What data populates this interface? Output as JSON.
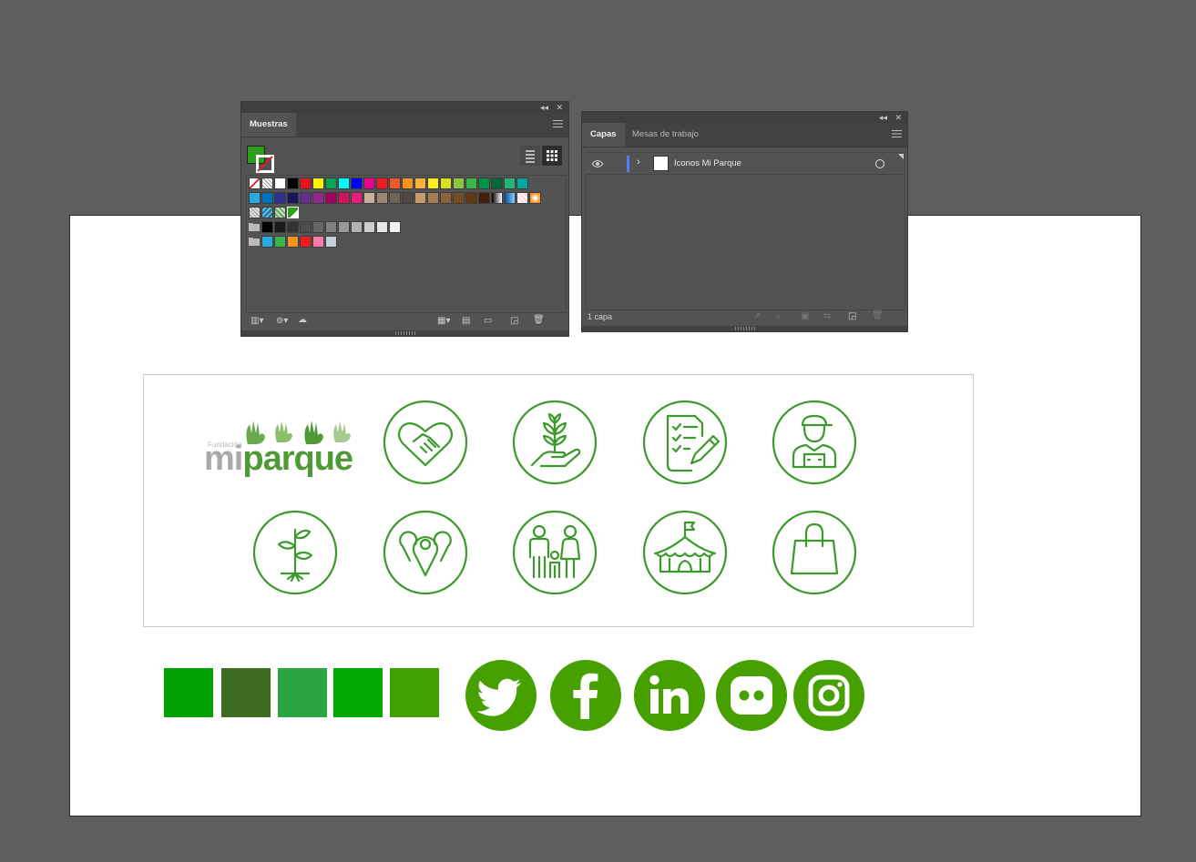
{
  "swatches_panel": {
    "tab": "Muestras",
    "fill_color": "#2ca01c",
    "rows": [
      [
        "none",
        "reg",
        "#ffffff",
        "#000000",
        "#e8141b",
        "#fff200",
        "#00a651",
        "#00ffff",
        "#0000ff",
        "#ec008c",
        "#ed1c24",
        "#f15a24",
        "#f7941e",
        "#fbb03b",
        "#fcee21",
        "#d9e021",
        "#8cc63f",
        "#39b54a",
        "#009245",
        "#006837",
        "#22b573",
        "#00a99d"
      ],
      [
        "#29abe2",
        "#0071bc",
        "#2e3192",
        "#1b1464",
        "#662d91",
        "#93278f",
        "#9e005d",
        "#d4145a",
        "#ed1e79",
        "#c7b299",
        "#998675",
        "#736357",
        "#534741",
        "#c69c6d",
        "#a67c52",
        "#8c6239",
        "#754c24",
        "#603813",
        "#42210b",
        "grad1",
        "grad2",
        "grad3",
        "grad4"
      ],
      [
        "pat1",
        "pat2",
        "pat3",
        "sel"
      ],
      [
        "folder",
        "#000000",
        "#1a1a1a",
        "#333333",
        "#4d4d4d",
        "#666666",
        "#808080",
        "#999999",
        "#b3b3b3",
        "#cccccc",
        "#e6e6e6",
        "#f2f2f2"
      ],
      [
        "folder",
        "#29abe2",
        "#39b54a",
        "#f7931e",
        "#ed1c24",
        "#ff7bac",
        "#c1d1dd"
      ]
    ]
  },
  "layers_panel": {
    "tabs": [
      "Capas",
      "Mesas de trabajo"
    ],
    "layer_name": "Iconos Mi Parque",
    "status": "1 capa"
  },
  "logo": {
    "small": "Fundación",
    "mi": "mi",
    "parque": "parque"
  },
  "brand_color": "#3c9a2c",
  "palette": [
    "#00a000",
    "#3e6b22",
    "#2ba542",
    "#00a800",
    "#3fa100"
  ],
  "social_color": "#45a000",
  "icons": [
    "handshake-heart-icon",
    "plant-hand-icon",
    "checklist-pencil-icon",
    "farmer-icon",
    "seedling-icon",
    "map-pins-icon",
    "family-icon",
    "circus-tent-icon",
    "shopping-bag-icon"
  ],
  "social": [
    "twitter-icon",
    "facebook-icon",
    "linkedin-icon",
    "flickr-icon",
    "instagram-icon"
  ]
}
